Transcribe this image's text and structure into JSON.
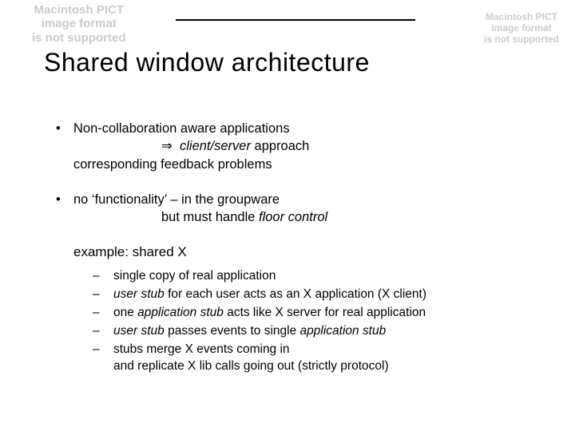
{
  "ghost": {
    "line1": "Macintosh PICT",
    "line2": "image format",
    "line3": "is not supported"
  },
  "title": "Shared window architecture",
  "bullet1": {
    "line1": "Non-collaboration aware applications",
    "arrow": "⇒",
    "line2_italic": "client/server",
    "line2_rest": " approach",
    "line3": "corresponding feedback problems"
  },
  "bullet2": {
    "line1": "no ‘functionality’ – in the groupware",
    "line2_pre": "but must handle ",
    "line2_italic": "floor control"
  },
  "example_head": "example: shared X",
  "subs": [
    {
      "text": "single copy of real application"
    },
    {
      "pre": "",
      "it1": "user stub",
      "mid": " for each user acts as an X application (X client)"
    },
    {
      "pre": "one ",
      "it1": "application stub",
      "mid": " acts like X server for real application"
    },
    {
      "pre": "",
      "it1": "user stub",
      "mid": " passes events to single ",
      "it2": "application stub"
    },
    {
      "text": "stubs merge X events coming in\nand replicate X lib calls going out (strictly protocol)"
    }
  ]
}
